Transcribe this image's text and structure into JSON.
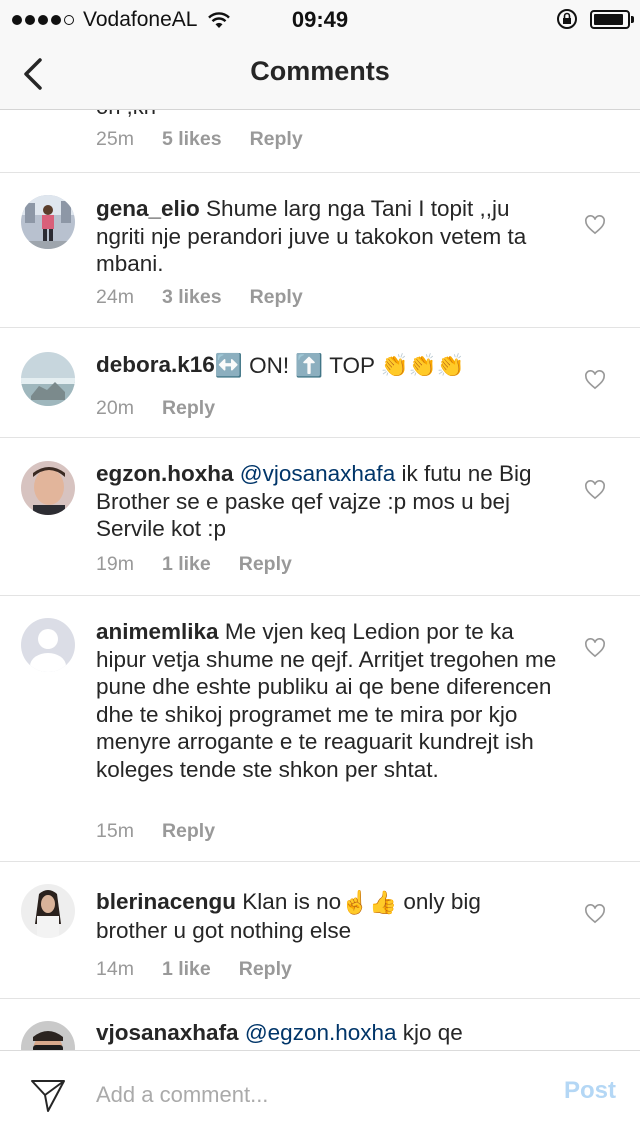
{
  "status_bar": {
    "carrier": "VodafoneAL",
    "time": "09:49",
    "battery_level": 0.9
  },
  "nav": {
    "title": "Comments"
  },
  "top_partial": {
    "text": "on ,kn",
    "time": "25m",
    "likes": "5 likes",
    "reply": "Reply"
  },
  "comments": [
    {
      "username": "gena_elio",
      "text": " Shume larg nga Tani I topit ,,ju ngriti nje perandori juve u takokon vetem ta mbani.",
      "time": "24m",
      "likes": "3 likes",
      "reply": "Reply"
    },
    {
      "username": "debora.k16",
      "emoji_text": " ↔️ ON! ⬆️ TOP 👏👏👏",
      "time": "20m",
      "reply": "Reply"
    },
    {
      "username": "egzon.hoxha",
      "mention": " @vjosanaxhafa",
      "text": " ik futu ne Big Brother se e paske qef vajze :p mos u bej Servile kot :p",
      "time": "19m",
      "likes": "1 like",
      "reply": "Reply"
    },
    {
      "username": "animemlika",
      "text": " Me vjen keq Ledion por te ka hipur vetja shume ne qejf. Arritjet tregohen me pune dhe eshte publiku ai qe bene diferencen dhe te shikoj programet me te mira  por kjo menyre arrogante e te reaguarit kundrejt ish koleges tende ste shkon per shtat.",
      "time": "15m",
      "reply": "Reply"
    },
    {
      "username": "blerinacengu",
      "text_a": " Klan is no",
      "emoji": "☝️👍",
      "text_b": "  only big brother u got nothing else",
      "time": "14m",
      "likes": "1 like",
      "reply": "Reply"
    },
    {
      "username": "vjosanaxhafa",
      "mention": " @egzon.hoxha",
      "text": " kjo qe"
    }
  ],
  "composer": {
    "placeholder": "Add a comment...",
    "post_label": "Post"
  },
  "colors": {
    "mention": "#003569",
    "meta": "#999999",
    "post_disabled": "#b4d7f5"
  }
}
